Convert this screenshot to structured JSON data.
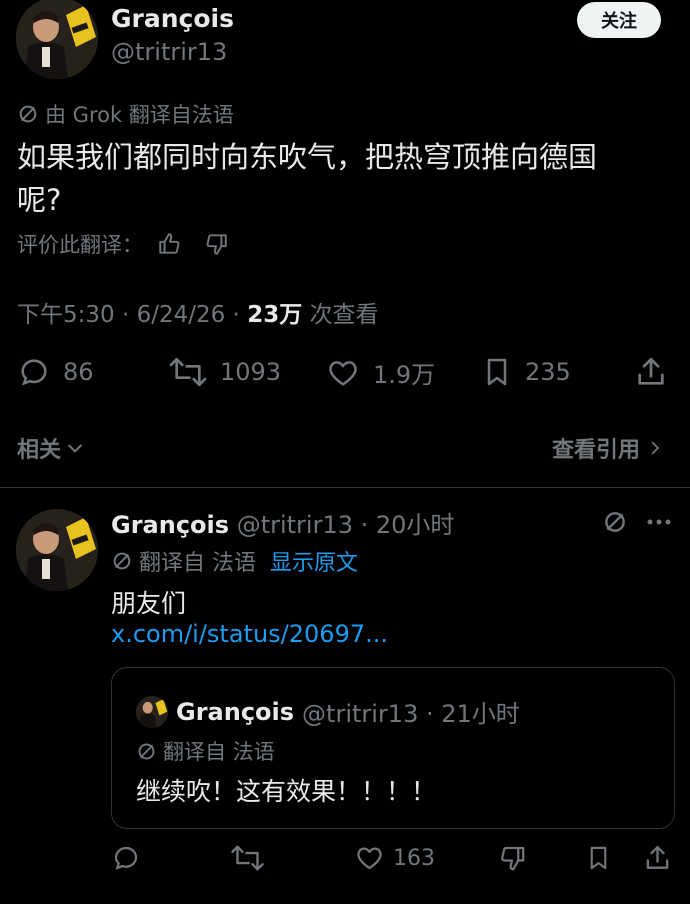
{
  "main_tweet": {
    "author_name": "Grançois",
    "author_handle": "@tritrir13",
    "follow_label": "关注",
    "translation_note": "由 Grok 翻译自法语",
    "text_line1": "如果我们都同时向东吹气，把热穹顶推向德国",
    "text_line2": "呢?",
    "rate_label": "评价此翻译：",
    "time_date": "下午5:30 · 6/24/26 · ",
    "views_count": "23万",
    "views_label": " 次查看",
    "actions": {
      "replies": "86",
      "retweets": "1093",
      "likes": "1.9万",
      "bookmarks": "235"
    }
  },
  "related_label": "相关",
  "view_quotes_label": "查看引用",
  "reply": {
    "author_name": "Grançois",
    "author_handle": "@tritrir13",
    "time": " · 20小时",
    "translation_note": "翻译自 法语",
    "show_original": "显示原文",
    "text": "朋友们",
    "link": "x.com/i/status/20697..."
  },
  "quoted": {
    "author_name": "Grançois",
    "author_handle": "@tritrir13",
    "time": " · 21小时",
    "translation_note": "翻译自 法语",
    "text": "继续吹！这有效果！！！！"
  },
  "reply_actions": {
    "likes": "163"
  },
  "colors": {
    "background": "#000000",
    "text": "#e7e9ea",
    "muted": "#71767b",
    "link": "#1d9bf0"
  },
  "icons": [
    "grok-translate-icon",
    "thumbs-up-icon",
    "thumbs-down-icon",
    "reply-icon",
    "retweet-icon",
    "like-icon",
    "bookmark-icon",
    "share-icon",
    "chevron-down-icon",
    "chevron-right-icon",
    "more-icon"
  ]
}
